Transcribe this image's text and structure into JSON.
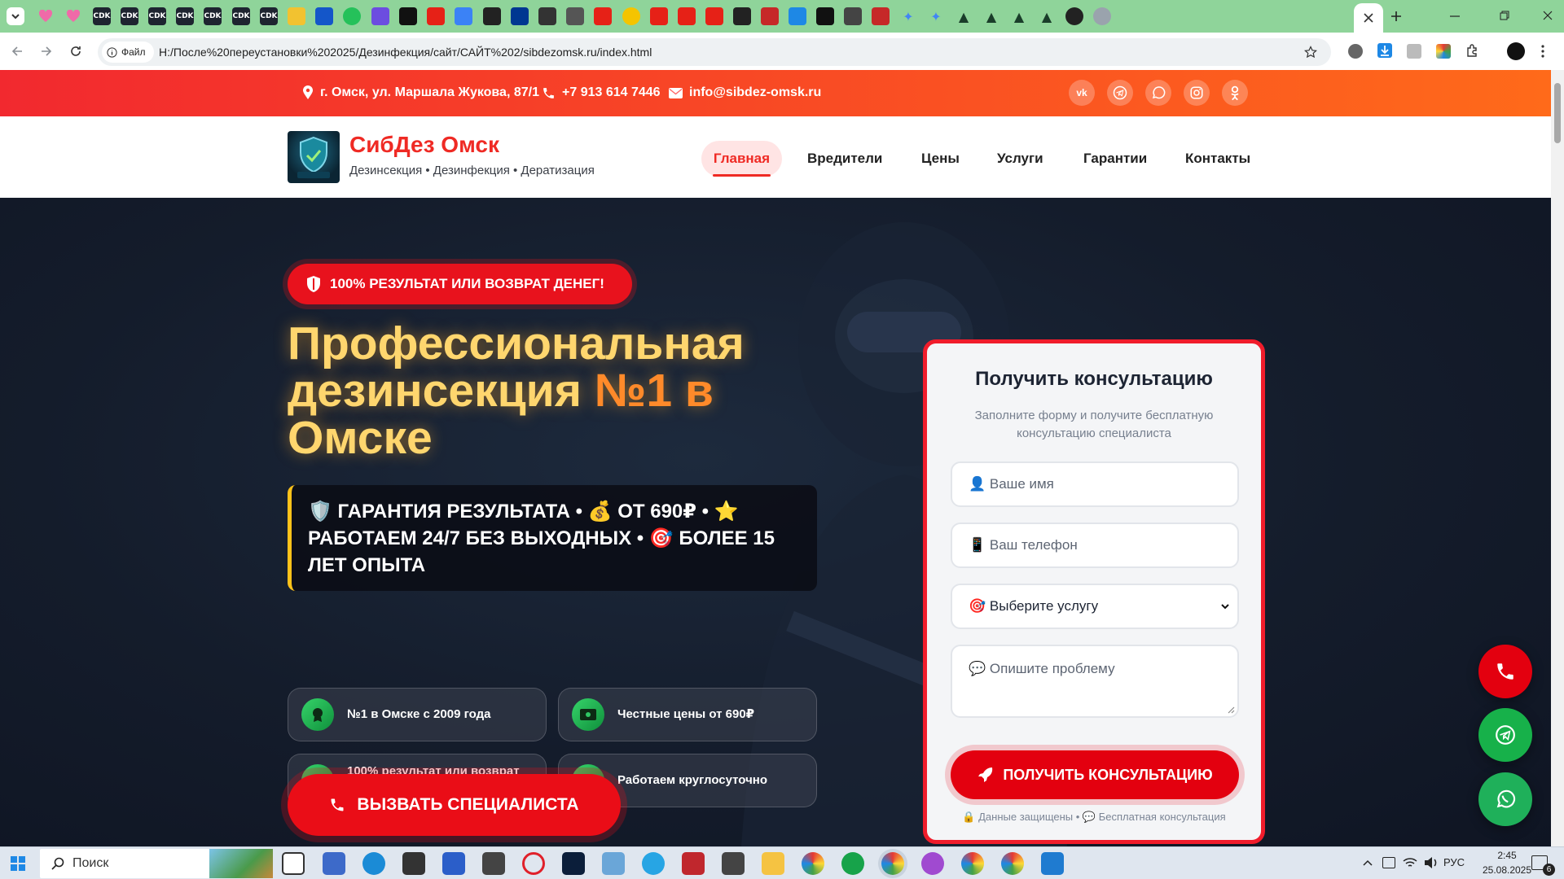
{
  "browser": {
    "file_chip": "Файл",
    "url": "H:/После%20переустановки%202025/Дезинфекция/сайт/САЙТ%202/sibdezomsk.ru/index.html",
    "tab_labels": [
      "CDK",
      "CDK",
      "CDK",
      "CDK",
      "CDK",
      "CDK",
      "CDK"
    ]
  },
  "topbar": {
    "address": "г. Омск, ул. Маршала Жукова, 87/1",
    "phone": "+7 913 614 7446",
    "email": "info@sibdez-omsk.ru",
    "socials": [
      "vk-icon",
      "telegram-icon",
      "whatsapp-icon",
      "instagram-icon",
      "odnoklassniki-icon"
    ]
  },
  "header": {
    "brand": "СибДез Омск",
    "tagline": "Дезинсекция • Дезинфекция • Дератизация",
    "nav": [
      "Главная",
      "Вредители",
      "Цены",
      "Услуги",
      "Гарантии",
      "Контакты"
    ],
    "active_nav": "Главная"
  },
  "hero": {
    "badge": "100% РЕЗУЛЬТАТ ИЛИ ВОЗВРАТ ДЕНЕГ!",
    "headline_main": "Профессиональная дезинсекция ",
    "headline_accent": "№1 в",
    "headline_end": " Омске",
    "ticker": "🛡️ ГАРАНТИЯ РЕЗУЛЬТАТА • 💰 ОТ 690₽ • ⭐ РАБОТАЕМ 24/7 БЕЗ ВЫХОДНЫХ • 🎯 БОЛЕЕ 15 ЛЕТ ОПЫТА",
    "features": [
      "№1 в Омске с 2009 года",
      "Честные цены от 690₽",
      "100% результат или возврат денег",
      "Работаем круглосуточно"
    ],
    "cta": "ВЫЗВАТЬ СПЕЦИАЛИСТА"
  },
  "form": {
    "title": "Получить консультацию",
    "subtitle": "Заполните форму и получите бесплатную консультацию специалиста",
    "name_placeholder": "👤 Ваше имя",
    "phone_placeholder": "📱 Ваш телефон",
    "service_selected": "🎯 Выберите услугу",
    "problem_placeholder": "💬 Опишите проблему",
    "submit": "ПОЛУЧИТЬ КОНСУЛЬТАЦИЮ",
    "note": "🔒 Данные защищены • 💬 Бесплатная консультация"
  },
  "taskbar": {
    "search": "Поиск",
    "lang": "РУС",
    "time": "2:45",
    "date": "25.08.2025",
    "notifications": "6"
  },
  "colors": {
    "accent_red": "#e8121d",
    "topbar_start": "#f2292f",
    "topbar_end": "#ff6a1a",
    "headline": "#ffd66e",
    "feature_green": "#1fb54f",
    "ticker_border": "#ffc21a"
  }
}
